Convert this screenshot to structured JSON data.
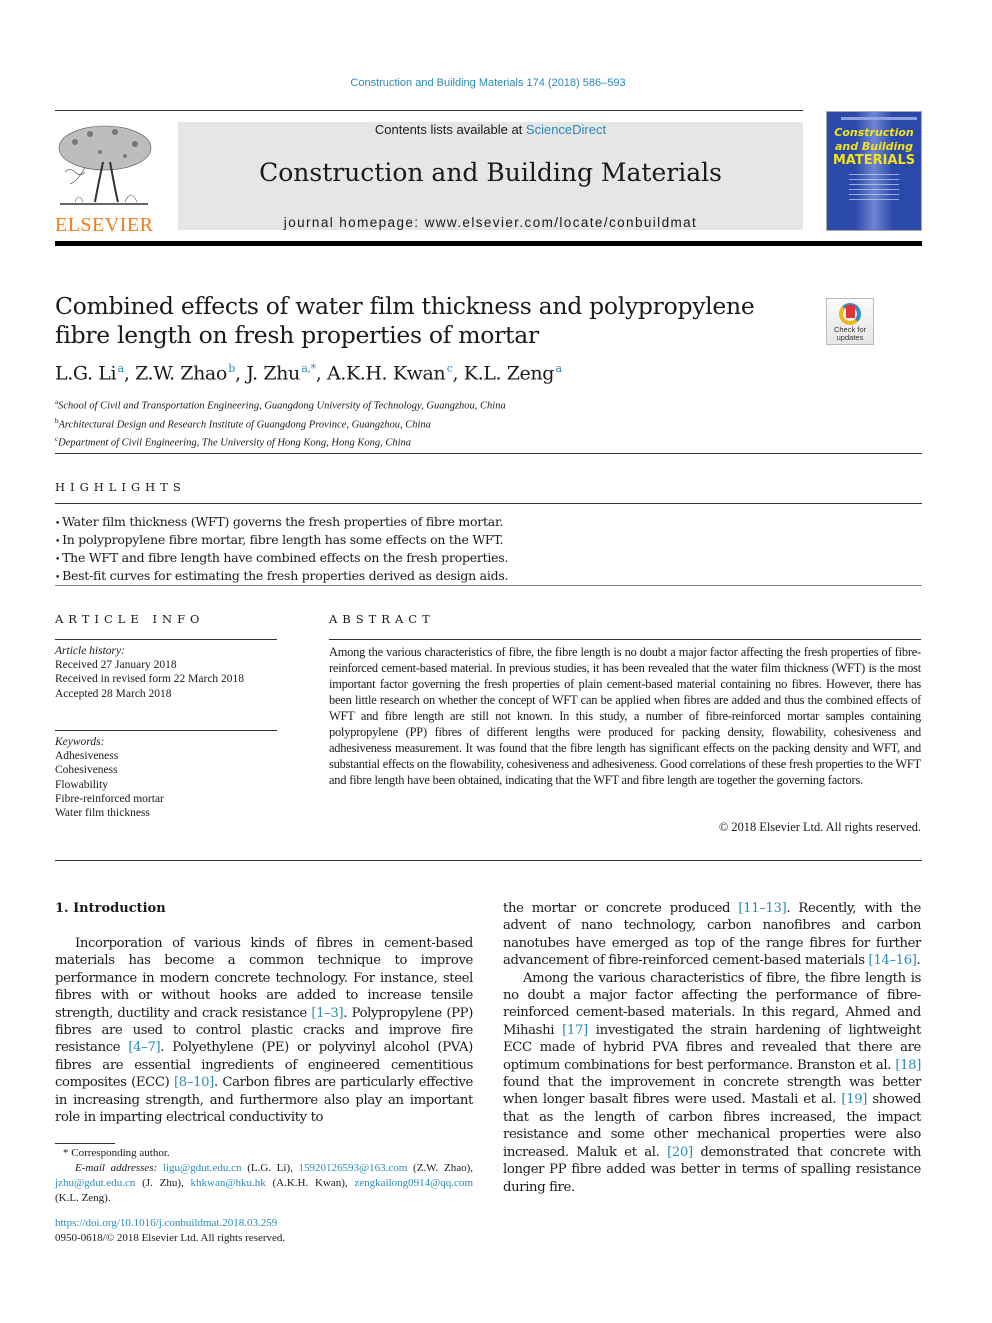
{
  "header": {
    "journal_reference": "Construction and Building Materials 174 (2018) 586–593",
    "publisher_logo_text": "ELSEVIER",
    "contents_prefix": "Contents lists available at ",
    "contents_link": "ScienceDirect",
    "journal_title": "Construction and Building Materials",
    "homepage_label": "journal homepage: www.elsevier.com/locate/conbuildmat",
    "cover": {
      "line1": "Construction",
      "line2": "and Building",
      "line3": "MATERIALS"
    },
    "colors": {
      "link": "#2a8ab8",
      "elsevier_orange": "#f07c1a",
      "cover_blue": "#2b49a8",
      "cover_yellow": "#f2e21a"
    }
  },
  "article": {
    "title": "Combined effects of water film thickness and polypropylene fibre length on fresh properties of mortar",
    "crossmark": {
      "line1": "Check for",
      "line2": "updates"
    },
    "authors": [
      {
        "name": "L.G. Li",
        "sup": "a"
      },
      {
        "name": "Z.W. Zhao",
        "sup": "b"
      },
      {
        "name": "J. Zhu",
        "sup": "a,*"
      },
      {
        "name": "A.K.H. Kwan",
        "sup": "c"
      },
      {
        "name": "K.L. Zeng",
        "sup": "a"
      }
    ],
    "affiliations": [
      {
        "mark": "a",
        "text": "School of Civil and Transportation Engineering, Guangdong University of Technology, Guangzhou, China"
      },
      {
        "mark": "b",
        "text": "Architectural Design and Research Institute of Guangdong Province, Guangzhou, China"
      },
      {
        "mark": "c",
        "text": "Department of Civil Engineering, The University of Hong Kong, Hong Kong, China"
      }
    ]
  },
  "highlights": {
    "label": "HIGHLIGHTS",
    "items": [
      "Water film thickness (WFT) governs the fresh properties of fibre mortar.",
      "In polypropylene fibre mortar, fibre length has some effects on the WFT.",
      "The WFT and fibre length have combined effects on the fresh properties.",
      "Best-fit curves for estimating the fresh properties derived as design aids."
    ]
  },
  "article_info": {
    "label": "ARTICLE INFO",
    "history_label": "Article history:",
    "history": [
      "Received 27 January 2018",
      "Received in revised form 22 March 2018",
      "Accepted 28 March 2018"
    ],
    "keywords_label": "Keywords:",
    "keywords": [
      "Adhesiveness",
      "Cohesiveness",
      "Flowability",
      "Fibre-reinforced mortar",
      "Water film thickness"
    ]
  },
  "abstract": {
    "label": "ABSTRACT",
    "text": "Among the various characteristics of fibre, the fibre length is no doubt a major factor affecting the fresh properties of fibre-reinforced cement-based material. In previous studies, it has been revealed that the water film thickness (WFT) is the most important factor governing the fresh properties of plain cement-based material containing no fibres. However, there has been little research on whether the concept of WFT can be applied when fibres are added and thus the combined effects of WFT and fibre length are still not known. In this study, a number of fibre-reinforced mortar samples containing polypropylene (PP) fibres of different lengths were produced for packing density, flowability, cohesiveness and adhesiveness measurement. It was found that the fibre length has significant effects on the packing density and WFT, and substantial effects on the flowability, cohesiveness and adhesiveness. Good correlations of these fresh properties to the WFT and fibre length have been obtained, indicating that the WFT and fibre length are together the governing factors.",
    "copyright": "© 2018 Elsevier Ltd. All rights reserved."
  },
  "body": {
    "intro_heading": "1. Introduction",
    "left_col": {
      "p1_a": "Incorporation of various kinds of fibres in cement-based materials has become a common technique to improve performance in modern concrete technology. For instance, steel fibres with or without hooks are added to increase tensile strength, ductility and crack resistance ",
      "ref1": "[1–3]",
      "p1_b": ". Polypropylene (PP) fibres are used to control plastic cracks and improve fire resistance ",
      "ref2": "[4–7]",
      "p1_c": ". Polyethylene (PE) or polyvinyl alcohol (PVA) fibres are essential ingredients of engineered cementitious composites (ECC) ",
      "ref3": "[8–10]",
      "p1_d": ". Carbon fibres are particularly effective in increasing strength, and furthermore also play an important role in imparting electrical conductivity to"
    },
    "right_col": {
      "p1_a": "the mortar or concrete produced ",
      "ref4": "[11–13]",
      "p1_b": ". Recently, with the advent of nano technology, carbon nanofibres and carbon nanotubes have emerged as top of the range fibres for further advancement of fibre-reinforced cement-based materials ",
      "ref5": "[14–16]",
      "p1_c": ".",
      "p2_a": "Among the various characteristics of fibre, the fibre length is no doubt a major factor affecting the performance of fibre-reinforced cement-based materials. In this regard, Ahmed and Mihashi ",
      "ref6": "[17]",
      "p2_b": " investigated the strain hardening of lightweight ECC made of hybrid PVA fibres and revealed that there are optimum combinations for best performance. Branston et al. ",
      "ref7": "[18]",
      "p2_c": " found that the improvement in concrete strength was better when longer basalt fibres were used. Mastali et al. ",
      "ref8": "[19]",
      "p2_d": " showed that as the length of carbon fibres increased, the impact resistance and some other mechanical properties were also increased. Maluk et al. ",
      "ref9": "[20]",
      "p2_e": " demonstrated that concrete with longer PP fibre added was better in terms of spalling resistance during fire."
    }
  },
  "footnotes": {
    "corresponding": "* Corresponding author.",
    "email_label": "E-mail addresses:",
    "emails": [
      {
        "email": "ligu@gdut.edu.cn",
        "who": " (L.G. Li), "
      },
      {
        "email": "15920126593@163.com",
        "who": " (Z.W. Zhao), "
      },
      {
        "email": "jzhu@gdut.edu.cn",
        "who": " (J. Zhu), "
      },
      {
        "email": "khkwan@hku.hk",
        "who": " (A.K.H. Kwan), "
      },
      {
        "email": "zengkailong0914@qq.com",
        "who": " (K.L. Zeng)."
      }
    ],
    "doi": "https://doi.org/10.1016/j.conbuildmat.2018.03.259",
    "issn": "0950-0618/© 2018 Elsevier Ltd. All rights reserved."
  }
}
